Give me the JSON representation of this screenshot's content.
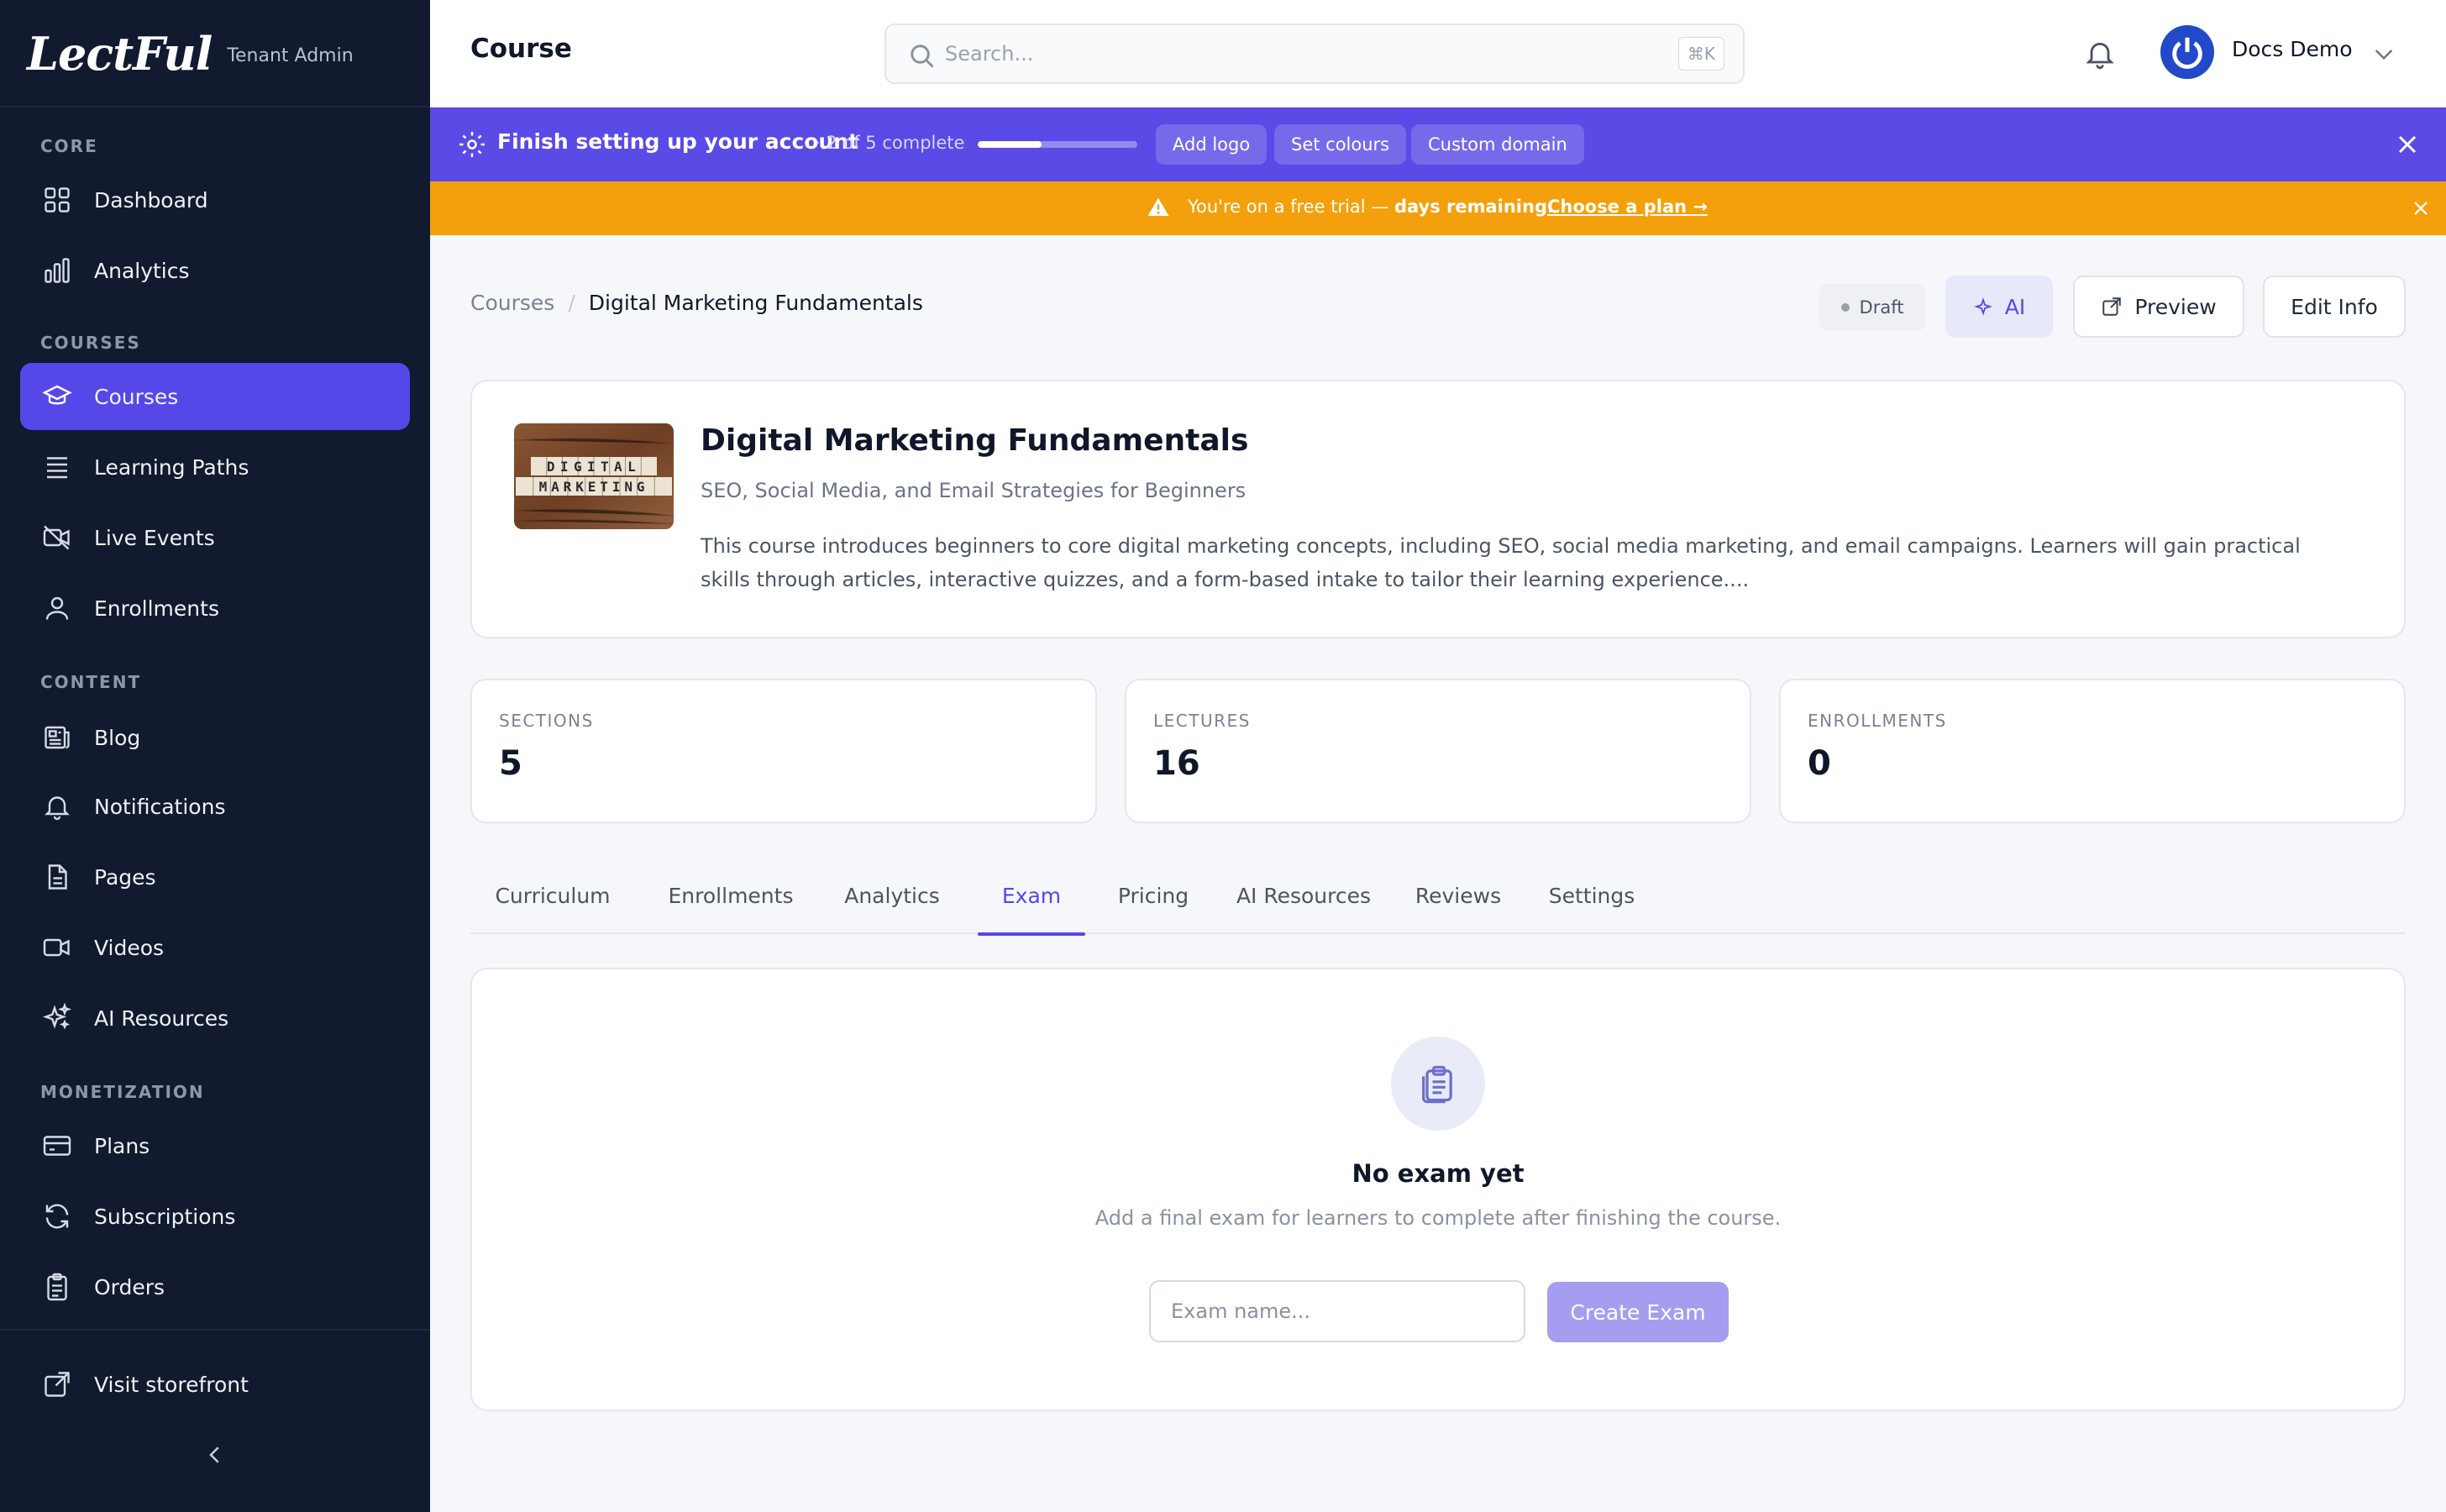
{
  "brand": {
    "logo": "LectFul",
    "subtitle": "Tenant Admin"
  },
  "sidebar": {
    "sections": [
      {
        "label": "CORE"
      },
      {
        "label": "COURSES"
      },
      {
        "label": "CONTENT"
      },
      {
        "label": "MONETIZATION"
      }
    ],
    "items": [
      {
        "label": "Dashboard",
        "icon": "grid-icon"
      },
      {
        "label": "Analytics",
        "icon": "bar-chart-icon"
      },
      {
        "label": "Courses",
        "icon": "graduation-cap-icon",
        "active": true
      },
      {
        "label": "Learning Paths",
        "icon": "list-icon"
      },
      {
        "label": "Live Events",
        "icon": "video-off-icon"
      },
      {
        "label": "Enrollments",
        "icon": "user-icon"
      },
      {
        "label": "Blog",
        "icon": "newspaper-icon"
      },
      {
        "label": "Notifications",
        "icon": "bell-icon"
      },
      {
        "label": "Pages",
        "icon": "file-icon"
      },
      {
        "label": "Videos",
        "icon": "video-icon"
      },
      {
        "label": "AI Resources",
        "icon": "sparkles-icon"
      },
      {
        "label": "Plans",
        "icon": "credit-card-icon"
      },
      {
        "label": "Subscriptions",
        "icon": "refresh-icon"
      },
      {
        "label": "Orders",
        "icon": "clipboard-icon"
      }
    ],
    "footer": {
      "visit_label": "Visit storefront"
    }
  },
  "header": {
    "title": "Course",
    "search": {
      "placeholder": "Search...",
      "shortcut": "⌘K"
    },
    "user": {
      "name": "Docs Demo"
    }
  },
  "setup_banner": {
    "title": "Finish setting up your account",
    "progress_text": "· 2 of 5 complete",
    "progress": 0.4,
    "chips": [
      "Add logo",
      "Set colours",
      "Custom domain"
    ]
  },
  "trial_banner": {
    "text_before": "You're on a free trial — ",
    "text_bold": "days remaining",
    "text_after": ".",
    "link": "Choose a plan →"
  },
  "breadcrumb": {
    "parent": "Courses",
    "separator": "/",
    "current": "Digital Marketing Fundamentals"
  },
  "actions": {
    "status": "Draft",
    "ai": "AI",
    "preview": "Preview",
    "edit": "Edit Info"
  },
  "course": {
    "thumb_row1": "DIGITAL",
    "thumb_row2": "MARKETING",
    "title": "Digital Marketing Fundamentals",
    "subtitle": "SEO, Social Media, and Email Strategies for Beginners",
    "description": "This course introduces beginners to core digital marketing concepts, including SEO, social media marketing, and email campaigns. Learners will gain practical skills through articles, interactive quizzes, and a form-based intake to tailor their learning experience...."
  },
  "stats": [
    {
      "label": "SECTIONS",
      "value": "5"
    },
    {
      "label": "LECTURES",
      "value": "16"
    },
    {
      "label": "ENROLLMENTS",
      "value": "0"
    }
  ],
  "tabs": [
    {
      "label": "Curriculum"
    },
    {
      "label": "Enrollments"
    },
    {
      "label": "Analytics"
    },
    {
      "label": "Exam",
      "active": true
    },
    {
      "label": "Pricing"
    },
    {
      "label": "AI Resources"
    },
    {
      "label": "Reviews"
    },
    {
      "label": "Settings"
    }
  ],
  "exam": {
    "title": "No exam yet",
    "description": "Add a final exam for learners to complete after finishing the course.",
    "input_placeholder": "Exam name...",
    "create_label": "Create Exam"
  },
  "colors": {
    "sidebar": "#111a2e",
    "accent": "#5648e8",
    "setup_banner": "#5a4ae6",
    "trial_banner": "#f4a00c"
  }
}
